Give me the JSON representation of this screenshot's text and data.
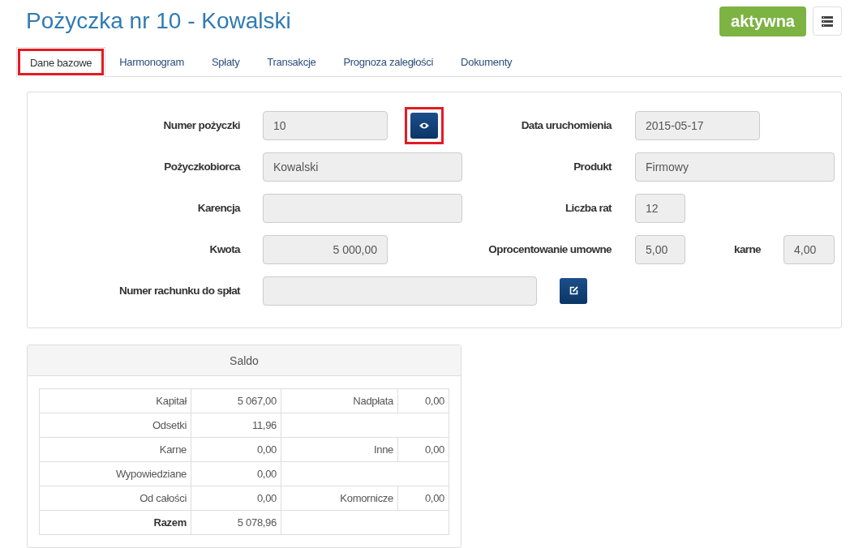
{
  "header": {
    "title": "Pożyczka nr 10 - Kowalski",
    "status_badge": "aktywna"
  },
  "tabs": [
    {
      "label": "Dane bazowe",
      "selected": true,
      "highlighted": true
    },
    {
      "label": "Harmonogram",
      "selected": false,
      "highlighted": false
    },
    {
      "label": "Spłaty",
      "selected": false,
      "highlighted": false
    },
    {
      "label": "Transakcje",
      "selected": false,
      "highlighted": false
    },
    {
      "label": "Prognoza zaległości",
      "selected": false,
      "highlighted": false
    },
    {
      "label": "Dokumenty",
      "selected": false,
      "highlighted": false
    }
  ],
  "form_rows": [
    {
      "label": "Numer pożyczki",
      "value": "10",
      "action": {
        "kind": "view",
        "highlighted": true
      },
      "right": {
        "label": "Data uruchomienia",
        "value": "2015-05-17"
      }
    },
    {
      "label": "Pożyczkobiorca",
      "value": "Kowalski",
      "right": {
        "label": "Produkt",
        "value": "Firmowy"
      }
    },
    {
      "label": "Karencja",
      "right": {
        "label": "Liczba rat",
        "value": "12"
      }
    },
    {
      "label": "Kwota",
      "value": "5 000,00",
      "right": {
        "label": "Oprocentowanie umowne",
        "value": "5,00",
        "extra_label": "karne",
        "extra_value": "4,00"
      }
    },
    {
      "label": "Numer rachunku do spłat",
      "action": {
        "kind": "edit",
        "highlighted": false
      }
    }
  ],
  "saldo": {
    "title": "Saldo",
    "rows": [
      {
        "kind": "item",
        "label": "Kapitał",
        "value": "5 067,00",
        "label_2": "Nadpłata",
        "value_2": "0,00"
      },
      {
        "kind": "item",
        "label": "Odsetki",
        "value": "11,96"
      },
      {
        "kind": "item",
        "label": "Karne",
        "value": "0,00",
        "label_2": "Inne",
        "value_2": "0,00"
      },
      {
        "kind": "item",
        "label": "Wypowiedziane",
        "value": "0,00"
      },
      {
        "kind": "item",
        "label": "Od całości",
        "value": "0,00",
        "label_2": "Komornicze",
        "value_2": "0,00"
      },
      {
        "kind": "total",
        "label": "Razem",
        "value": "5 078,96"
      }
    ]
  }
}
